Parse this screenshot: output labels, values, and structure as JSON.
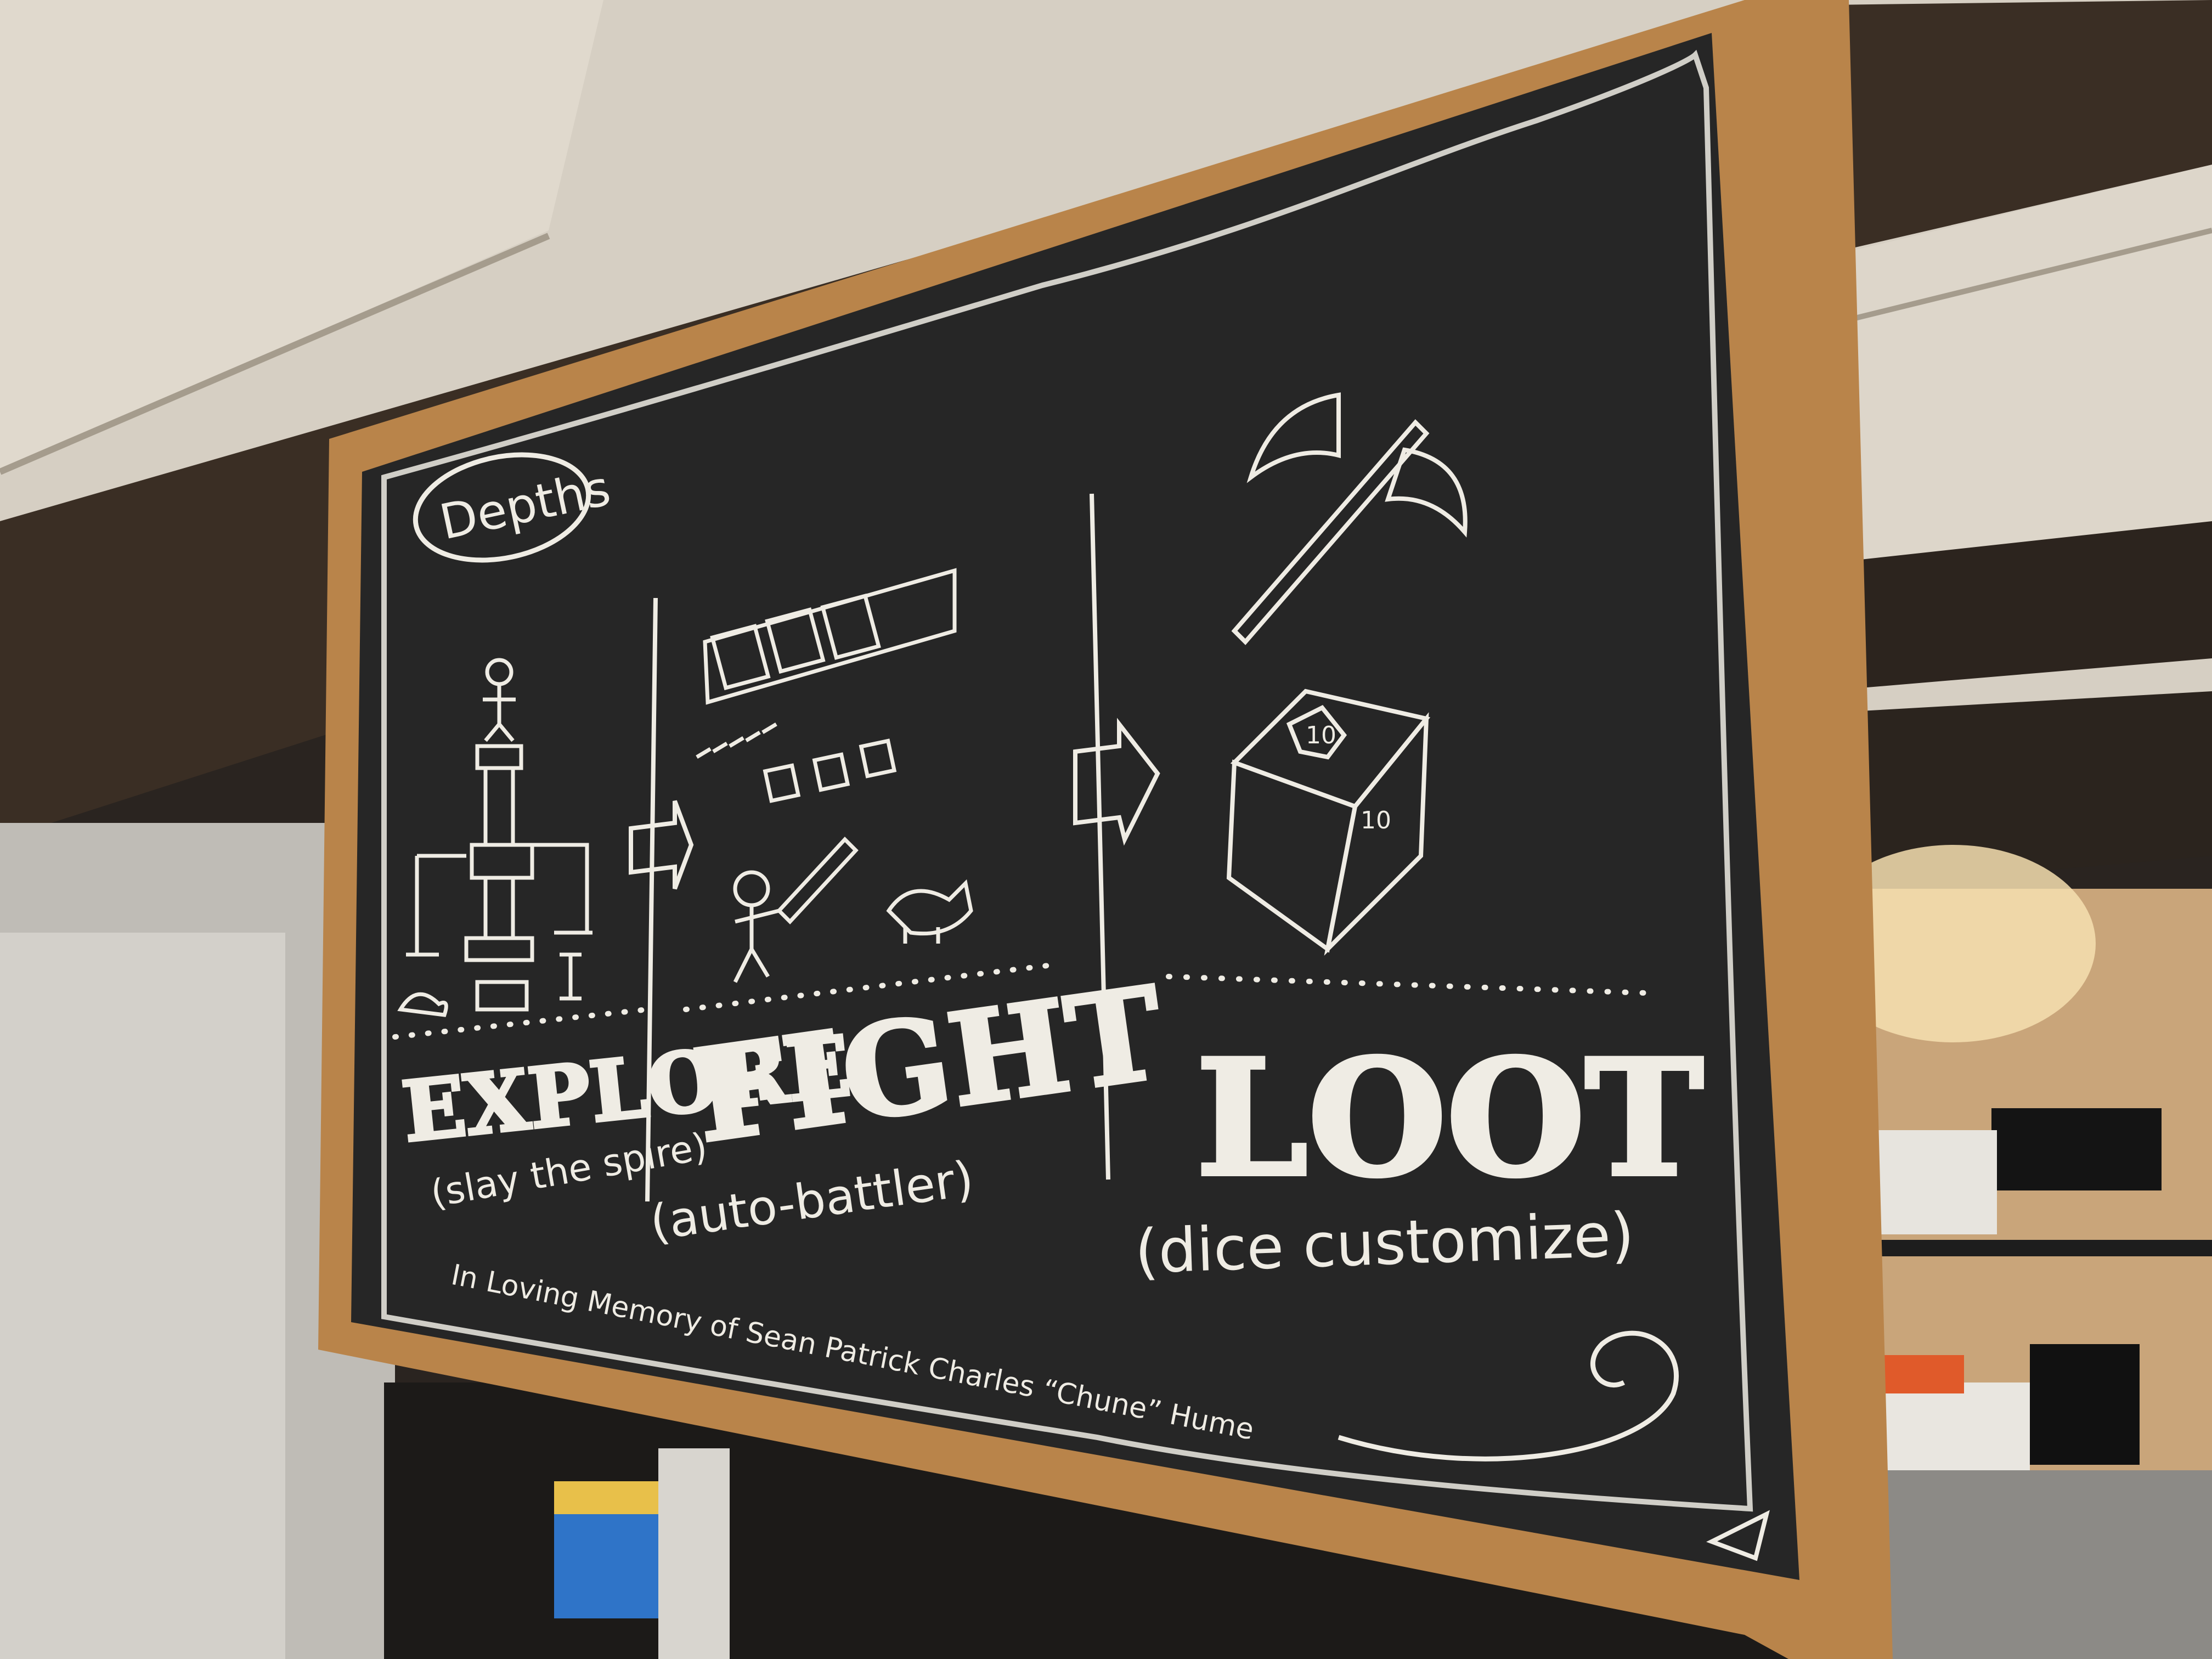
{
  "board": {
    "title": "Depths",
    "stages": [
      {
        "label": "EXPLORE",
        "sub": "(slay the spire)"
      },
      {
        "label": "FIGHT",
        "sub": "(auto-battler)"
      },
      {
        "label": "LOOT",
        "sub": "(dice customize)"
      }
    ],
    "dedication": "In Loving Memory of Sean Patrick Charles “Chune” Hume"
  },
  "colors": {
    "frame": "#b9844a",
    "chalkboard": "#262626",
    "chalk": "#efece4",
    "ceiling": "#d9d2c6",
    "beam": "#3a2e24",
    "lamp_glow": "#f3d39a"
  }
}
